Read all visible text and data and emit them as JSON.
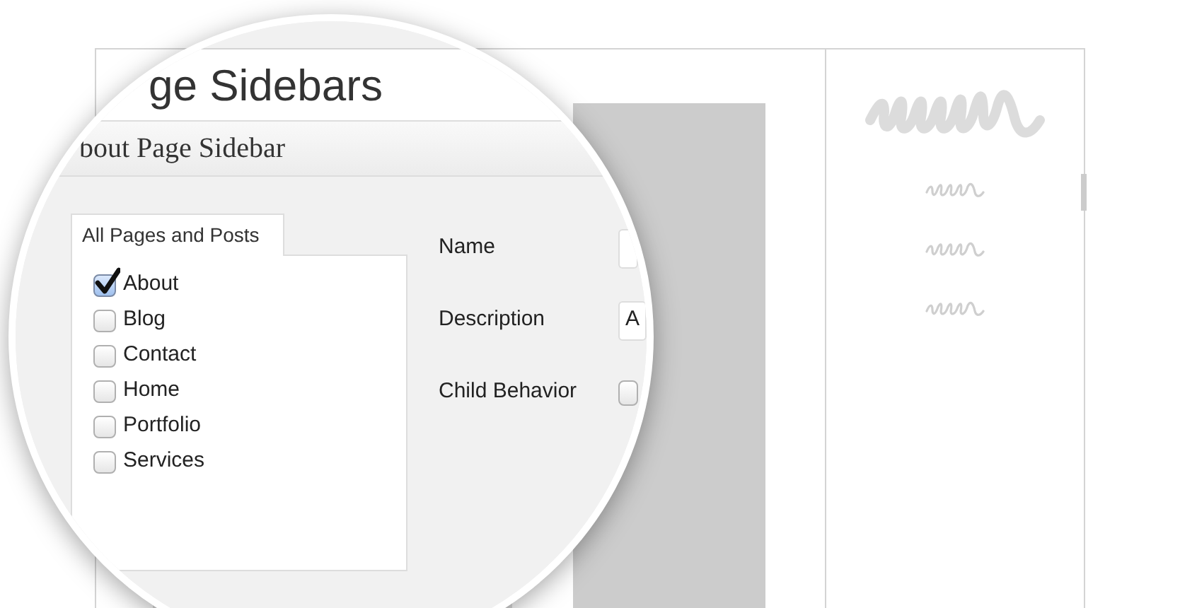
{
  "page": {
    "title": "ge Sidebars"
  },
  "sidebar_box": {
    "title": "bout Page Sidebar",
    "tab": {
      "label": "All Pages and Posts"
    },
    "pages": [
      {
        "label": "About",
        "checked": true
      },
      {
        "label": "Blog",
        "checked": false
      },
      {
        "label": "Contact",
        "checked": false
      },
      {
        "label": "Home",
        "checked": false
      },
      {
        "label": "Portfolio",
        "checked": false
      },
      {
        "label": "Services",
        "checked": false
      }
    ]
  },
  "fields": [
    {
      "kind": "text",
      "label": "Name"
    },
    {
      "kind": "text",
      "label": "Description",
      "value": "A"
    },
    {
      "kind": "select",
      "label": "Child Behavior"
    }
  ]
}
